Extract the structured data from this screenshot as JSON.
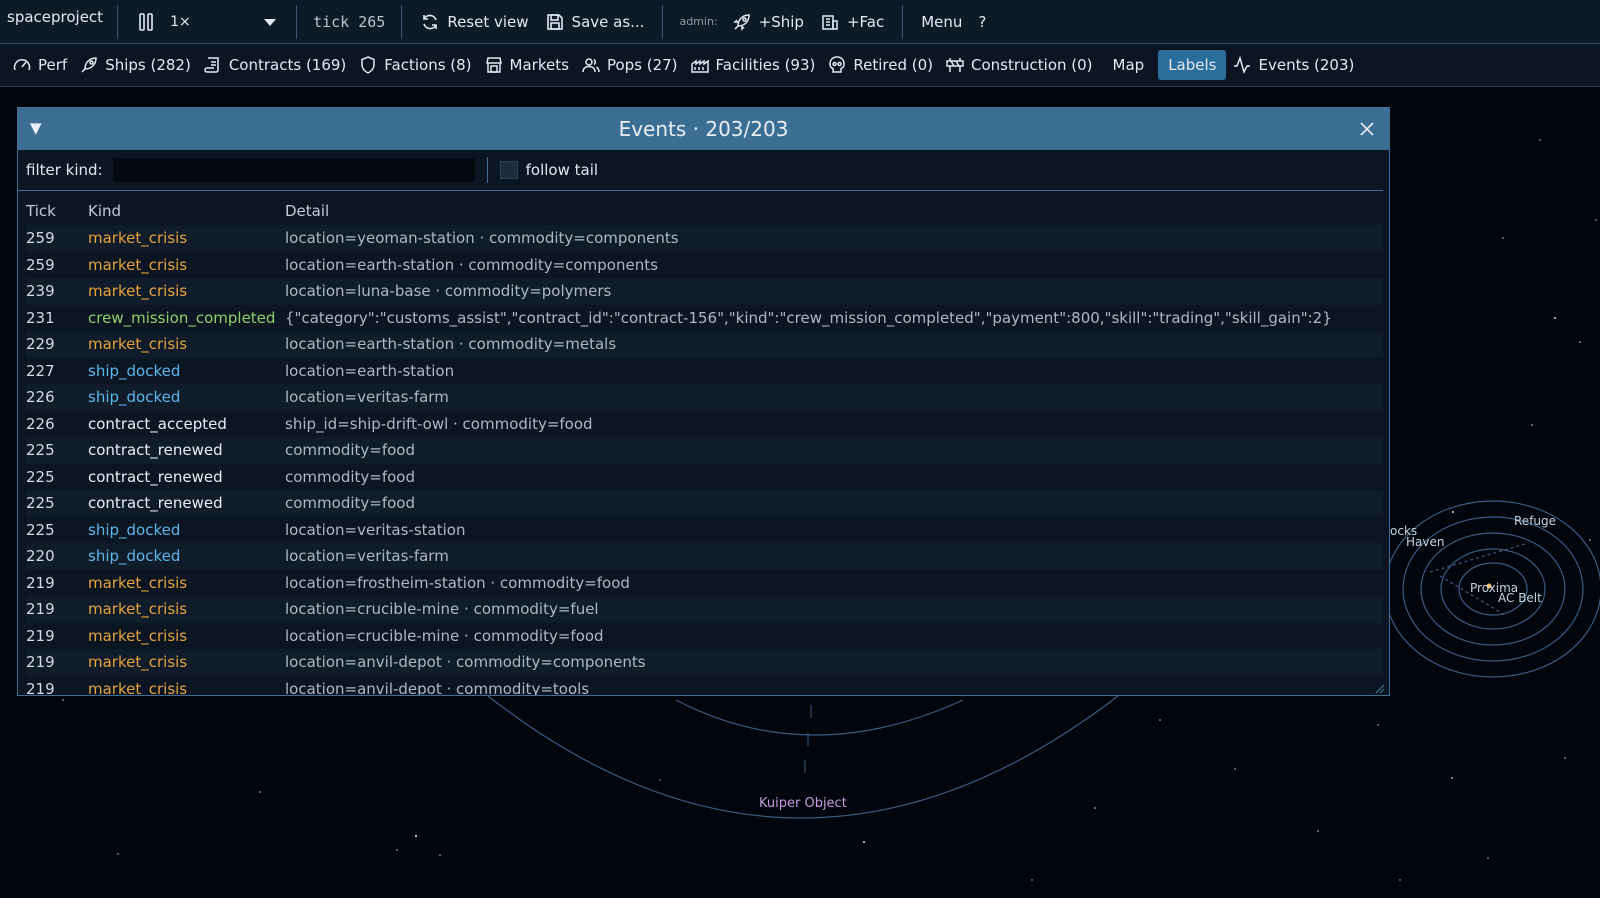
{
  "colors": {
    "kind_market_crisis": "#e6a23c",
    "kind_ship_docked": "#5bb6ea",
    "kind_crew_mission_completed": "#8fd06a",
    "kind_contract": "#e8edf2",
    "accent": "#2a6e9c",
    "window_title_bg": "#3c6e93"
  },
  "toolbar": {
    "app_name": "spaceproject",
    "pause_icon": "pause-icon",
    "speed_value": "1×",
    "tick": "tick 265",
    "reset_view": "Reset view",
    "save_as": "Save as...",
    "admin_label": "admin:",
    "add_ship": "+Ship",
    "add_fac": "+Fac",
    "menu": "Menu",
    "help": "?"
  },
  "nav": {
    "perf": "Perf",
    "ships": "Ships (282)",
    "contracts": "Contracts (169)",
    "factions": "Factions (8)",
    "markets": "Markets",
    "pops": "Pops (27)",
    "facilities": "Facilities (93)",
    "retired": "Retired (0)",
    "construction": "Construction (0)",
    "map": "Map",
    "labels": "Labels",
    "events": "Events (203)"
  },
  "events_window": {
    "title": "Events · 203/203",
    "filter_label": "filter kind:",
    "filter_value": "",
    "follow_tail_label": "follow tail",
    "follow_tail_checked": false,
    "columns": {
      "tick": "Tick",
      "kind": "Kind",
      "detail": "Detail"
    },
    "rows": [
      {
        "tick": "259",
        "kind": "market_crisis",
        "detail": "location=yeoman-station · commodity=components"
      },
      {
        "tick": "259",
        "kind": "market_crisis",
        "detail": "location=earth-station · commodity=components"
      },
      {
        "tick": "239",
        "kind": "market_crisis",
        "detail": "location=luna-base · commodity=polymers"
      },
      {
        "tick": "231",
        "kind": "crew_mission_completed",
        "detail": "{\"category\":\"customs_assist\",\"contract_id\":\"contract-156\",\"kind\":\"crew_mission_completed\",\"payment\":800,\"skill\":\"trading\",\"skill_gain\":2}"
      },
      {
        "tick": "229",
        "kind": "market_crisis",
        "detail": "location=earth-station · commodity=metals"
      },
      {
        "tick": "227",
        "kind": "ship_docked",
        "detail": "location=earth-station"
      },
      {
        "tick": "226",
        "kind": "ship_docked",
        "detail": "location=veritas-farm"
      },
      {
        "tick": "226",
        "kind": "contract_accepted",
        "detail": "ship_id=ship-drift-owl · commodity=food"
      },
      {
        "tick": "225",
        "kind": "contract_renewed",
        "detail": "commodity=food"
      },
      {
        "tick": "225",
        "kind": "contract_renewed",
        "detail": "commodity=food"
      },
      {
        "tick": "225",
        "kind": "contract_renewed",
        "detail": "commodity=food"
      },
      {
        "tick": "225",
        "kind": "ship_docked",
        "detail": "location=veritas-station"
      },
      {
        "tick": "220",
        "kind": "ship_docked",
        "detail": "location=veritas-farm"
      },
      {
        "tick": "219",
        "kind": "market_crisis",
        "detail": "location=frostheim-station · commodity=food"
      },
      {
        "tick": "219",
        "kind": "market_crisis",
        "detail": "location=crucible-mine · commodity=fuel"
      },
      {
        "tick": "219",
        "kind": "market_crisis",
        "detail": "location=crucible-mine · commodity=food"
      },
      {
        "tick": "219",
        "kind": "market_crisis",
        "detail": "location=anvil-depot · commodity=components"
      },
      {
        "tick": "219",
        "kind": "market_crisis",
        "detail": "location=anvil-depot · commodity=tools"
      }
    ]
  },
  "map_labels": {
    "kuiper": "Kuiper Object",
    "rocks": "ocks",
    "haven": "Haven",
    "refuge": "Refuge",
    "proxima": "Proxima",
    "ac_belt": "AC Belt"
  }
}
